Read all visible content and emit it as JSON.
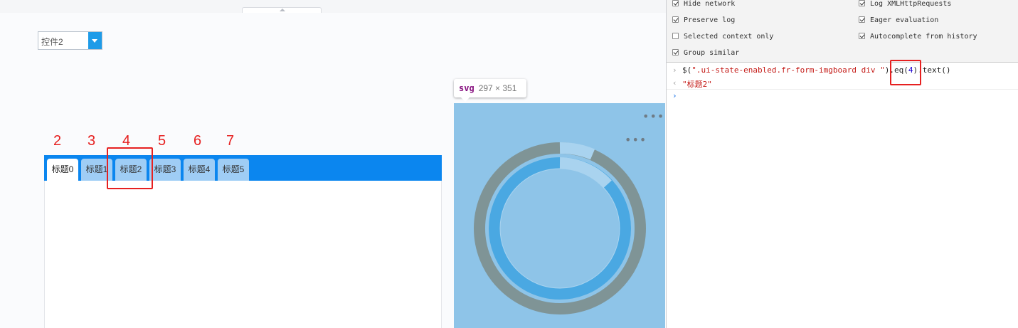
{
  "combo": {
    "value": "控件2"
  },
  "annotations": [
    "2",
    "3",
    "4",
    "5",
    "6",
    "7"
  ],
  "tabs": [
    "标题0",
    "标题1",
    "标题2",
    "标题3",
    "标题4",
    "标题5"
  ],
  "tooltip": {
    "tag": "svg",
    "dims": "297 × 351"
  },
  "devtools": {
    "options_left": [
      {
        "label": "Hide network",
        "checked": true
      },
      {
        "label": "Preserve log",
        "checked": true
      },
      {
        "label": "Selected context only",
        "checked": false
      },
      {
        "label": "Group similar",
        "checked": true
      }
    ],
    "options_right": [
      {
        "label": "Log XMLHttpRequests",
        "checked": true
      },
      {
        "label": "Eager evaluation",
        "checked": true
      },
      {
        "label": "Autocomplete from history",
        "checked": true
      }
    ],
    "console": {
      "cmd_part1": "$(",
      "cmd_string": "\".ui-state-enabled.fr-form-imgboard div \"",
      "cmd_part2": ").",
      "cmd_eq_open": "eq(",
      "cmd_eq_arg": "4",
      "cmd_eq_close": ")",
      "cmd_part3": ".text()",
      "result": "\"标题2\""
    }
  },
  "colors": {
    "tab_strip": "#0b86ef",
    "tab_inactive": "#9fcdf5",
    "highlight_red": "#e62020",
    "svg_highlight": "#8ec4e8"
  },
  "gauge": {
    "outer_ring": "#7f9496",
    "inner_ring": "#4aa8e2"
  }
}
